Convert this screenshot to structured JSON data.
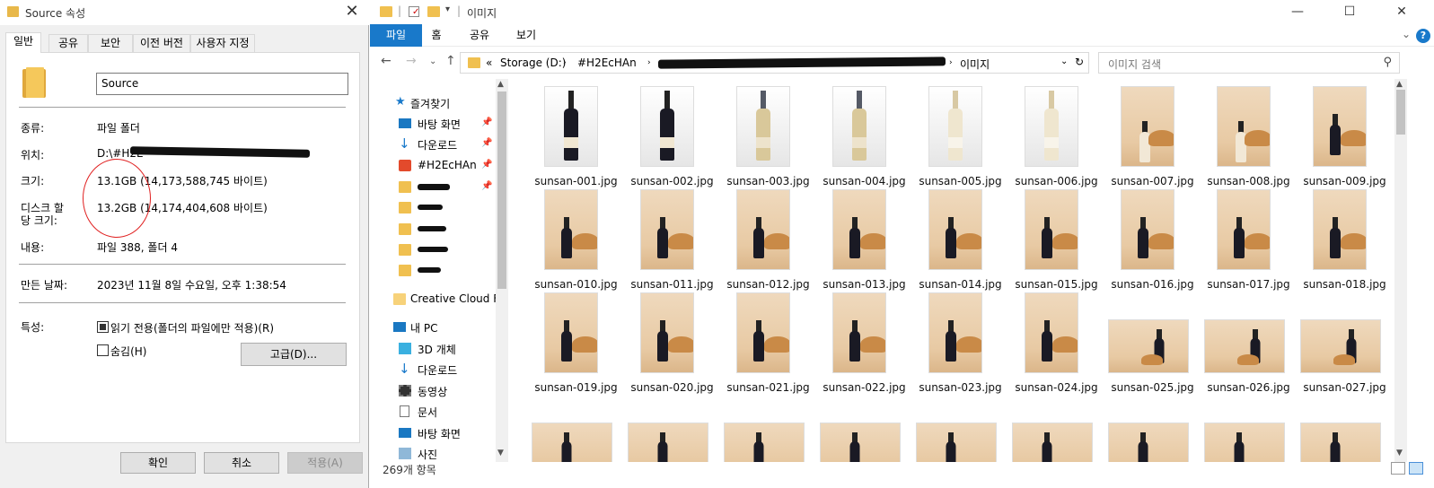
{
  "dialog": {
    "title": "Source 속성",
    "tabs": [
      "일반",
      "공유",
      "보안",
      "이전 버전",
      "사용자 지정"
    ],
    "name_value": "Source",
    "rows": {
      "type_label": "종류:",
      "type_value": "파일 폴더",
      "location_label": "위치:",
      "location_value": "D:\\#H2E",
      "size_label": "크기:",
      "size_value": "13.1GB (14,173,588,745 바이트)",
      "disk_label_1": "디스크 할",
      "disk_label_2": "당 크기:",
      "disk_value": "13.2GB (14,174,404,608 바이트)",
      "contents_label": "내용:",
      "contents_value": "파일 388, 폴더 4",
      "created_label": "만든 날짜:",
      "created_value": "2023년 11월 8일 수요일, 오후 1:38:54",
      "attributes_label": "특성:"
    },
    "readonly_label": "읽기 전용(폴더의 파일에만 적용)(R)",
    "hidden_label": "숨김(H)",
    "advanced_button": "고급(D)...",
    "ok_button": "확인",
    "cancel_button": "취소",
    "apply_button": "적용(A)"
  },
  "explorer": {
    "window_title": "이미지",
    "ribbon_tabs": [
      "파일",
      "홈",
      "공유",
      "보기"
    ],
    "help": "?",
    "address": {
      "prefix": "«",
      "crumbs": [
        "Storage (D:)",
        "#H2EcHAn",
        "이미지"
      ]
    },
    "search_placeholder": "이미지 검색",
    "nav": {
      "quick_access": "즐겨찾기",
      "items": [
        "바탕 화면",
        "다운로드",
        "#H2EcHAn",
        "Creative Cloud Fil",
        "내 PC",
        "3D 개체",
        "다운로드",
        "동영상",
        "문서",
        "바탕 화면",
        "사진"
      ]
    },
    "files": [
      "sunsan-001.jpg",
      "sunsan-002.jpg",
      "sunsan-003.jpg",
      "sunsan-004.jpg",
      "sunsan-005.jpg",
      "sunsan-006.jpg",
      "sunsan-007.jpg",
      "sunsan-008.jpg",
      "sunsan-009.jpg",
      "sunsan-010.jpg",
      "sunsan-011.jpg",
      "sunsan-012.jpg",
      "sunsan-013.jpg",
      "sunsan-014.jpg",
      "sunsan-015.jpg",
      "sunsan-016.jpg",
      "sunsan-017.jpg",
      "sunsan-018.jpg",
      "sunsan-019.jpg",
      "sunsan-020.jpg",
      "sunsan-021.jpg",
      "sunsan-022.jpg",
      "sunsan-023.jpg",
      "sunsan-024.jpg",
      "sunsan-025.jpg",
      "sunsan-026.jpg",
      "sunsan-027.jpg"
    ],
    "status_text": "269개 항목",
    "colors": {
      "accent": "#1979ca",
      "folder": "#f0c050",
      "annotation": "#e02020"
    }
  }
}
